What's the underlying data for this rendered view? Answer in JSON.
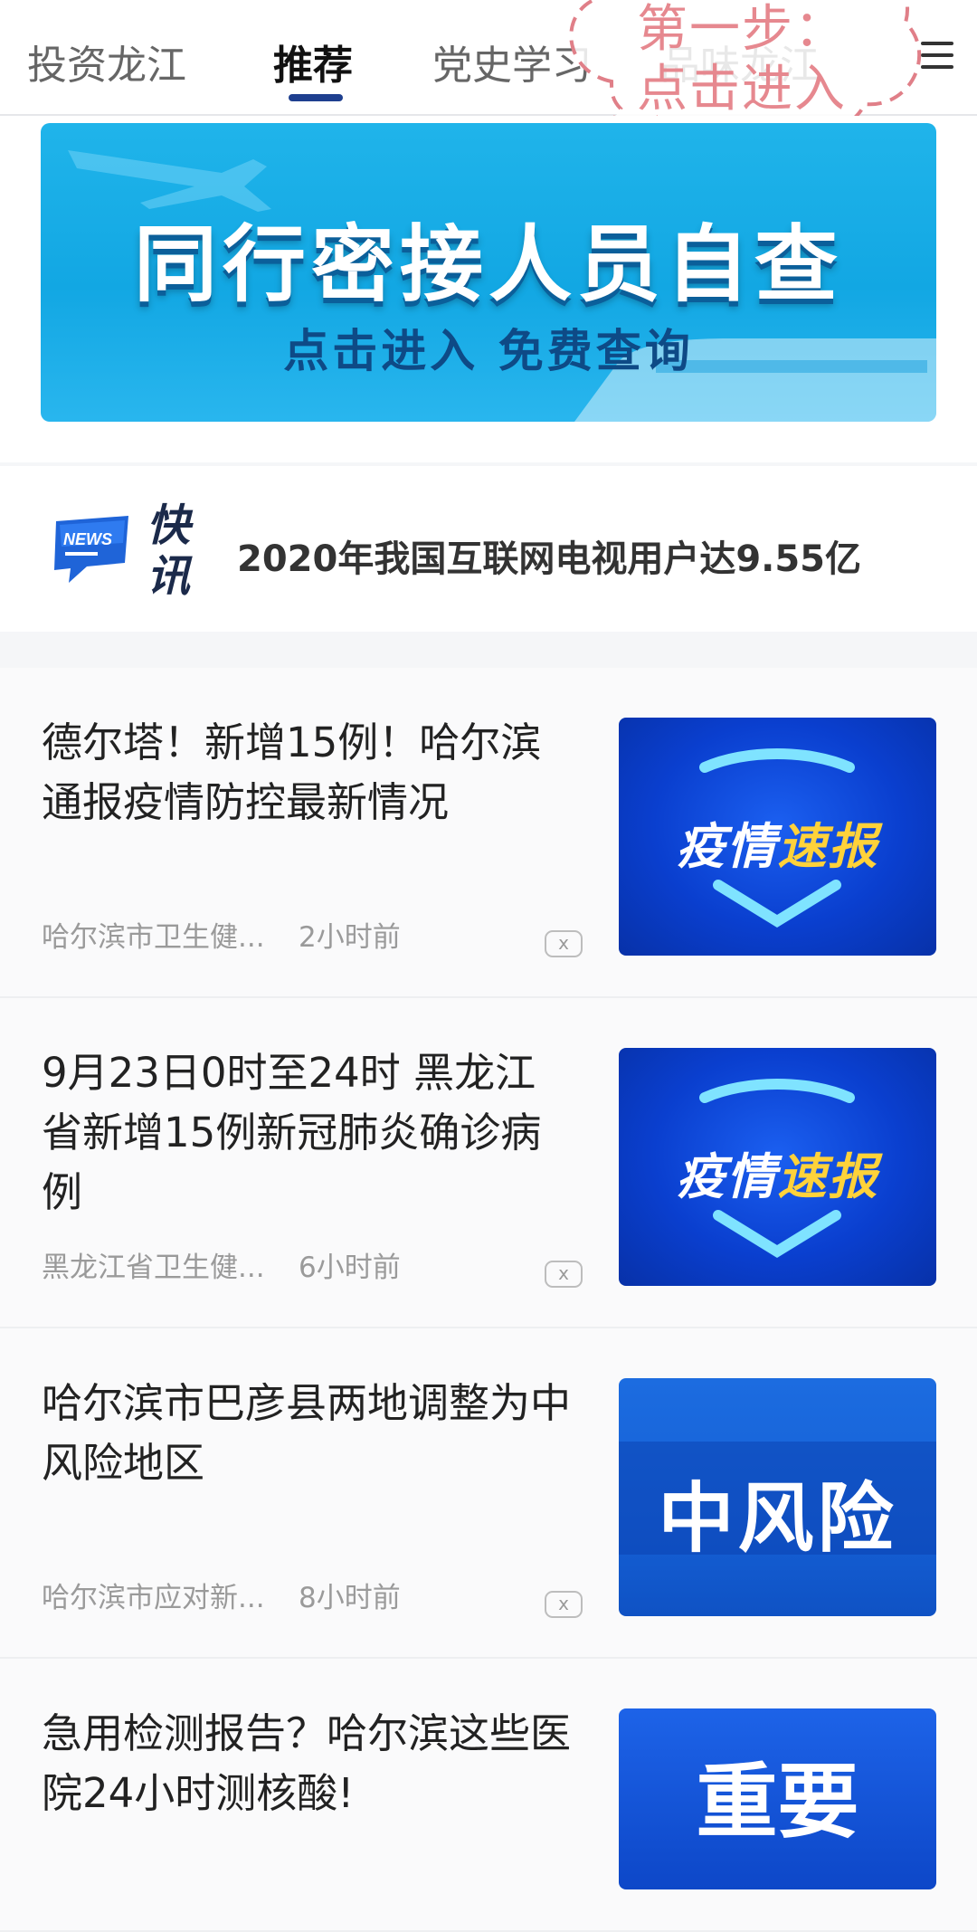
{
  "tabs": [
    {
      "label": "投资龙江",
      "active": false
    },
    {
      "label": "推荐",
      "active": true
    },
    {
      "label": "党史学习",
      "active": false
    },
    {
      "label": "品味龙江",
      "active": false
    }
  ],
  "overlay_note": {
    "line1": "第一步：",
    "line2": "点击进入"
  },
  "banner": {
    "title": "同行密接人员自查",
    "subtitle": "点击进入  免费查询"
  },
  "news_flash": {
    "badge": "NEWS",
    "label": "快讯",
    "headline": "2020年我国互联网电视用户达9.55亿"
  },
  "articles": [
    {
      "title": "德尔塔！新增15例！哈尔滨通报疫情防控最新情况",
      "source": "哈尔滨市卫生健...",
      "time": "2小时前",
      "thumb_label_a": "疫情",
      "thumb_label_b": "速报"
    },
    {
      "title": "9月23日0时至24时 黑龙江省新增15例新冠肺炎确诊病例",
      "source": "黑龙江省卫生健...",
      "time": "6小时前",
      "thumb_label_a": "疫情",
      "thumb_label_b": "速报"
    },
    {
      "title": "哈尔滨市巴彦县两地调整为中风险地区",
      "source": "哈尔滨市应对新...",
      "time": "8小时前",
      "thumb_label": "中风险"
    },
    {
      "title": "急用检测报告？哈尔滨这些医院24小时测核酸!",
      "thumb_label": "重要"
    }
  ],
  "close_glyph": "x",
  "colors": {
    "accent": "#1e3f8f",
    "banner": "#12a7e3",
    "thumb_blue": "#0a3fcf",
    "highlight": "#ffd23a"
  }
}
